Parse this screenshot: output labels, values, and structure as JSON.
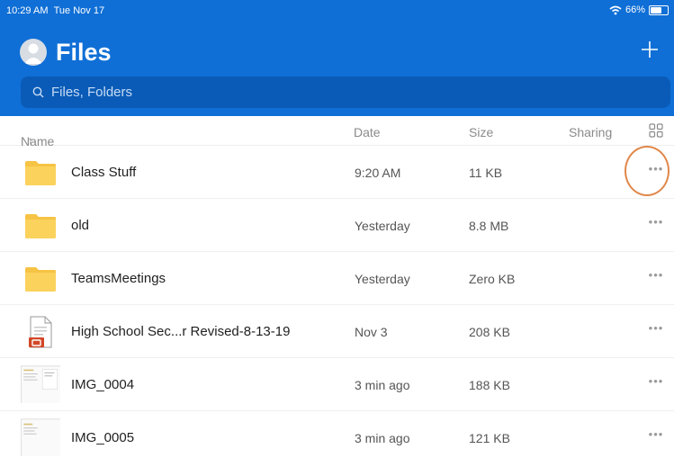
{
  "status": {
    "time": "10:29 AM",
    "date": "Tue Nov 17",
    "battery": "66%"
  },
  "header": {
    "title": "Files"
  },
  "search": {
    "placeholder": "Files, Folders"
  },
  "columns": {
    "name": "Name",
    "date": "Date",
    "size": "Size",
    "sharing": "Sharing"
  },
  "files": [
    {
      "name": "Class Stuff",
      "date": "9:20 AM",
      "size": "11 KB",
      "icon": "folder-icon"
    },
    {
      "name": "old",
      "date": "Yesterday",
      "size": "8.8 MB",
      "icon": "folder-icon"
    },
    {
      "name": "TeamsMeetings",
      "date": "Yesterday",
      "size": "Zero KB",
      "icon": "folder-icon"
    },
    {
      "name": "High School Sec...r Revised-8-13-19",
      "date": "Nov 3",
      "size": "208 KB",
      "icon": "presentation-file-icon"
    },
    {
      "name": "IMG_0004",
      "date": "3 min ago",
      "size": "188 KB",
      "icon": "image-thumbnail"
    },
    {
      "name": "IMG_0005",
      "date": "3 min ago",
      "size": "121 KB",
      "icon": "image-thumbnail"
    }
  ],
  "more_label": "•••",
  "colors": {
    "accent": "#0f6fd6",
    "folder": "#f6c344",
    "highlight": "#e0874a"
  }
}
